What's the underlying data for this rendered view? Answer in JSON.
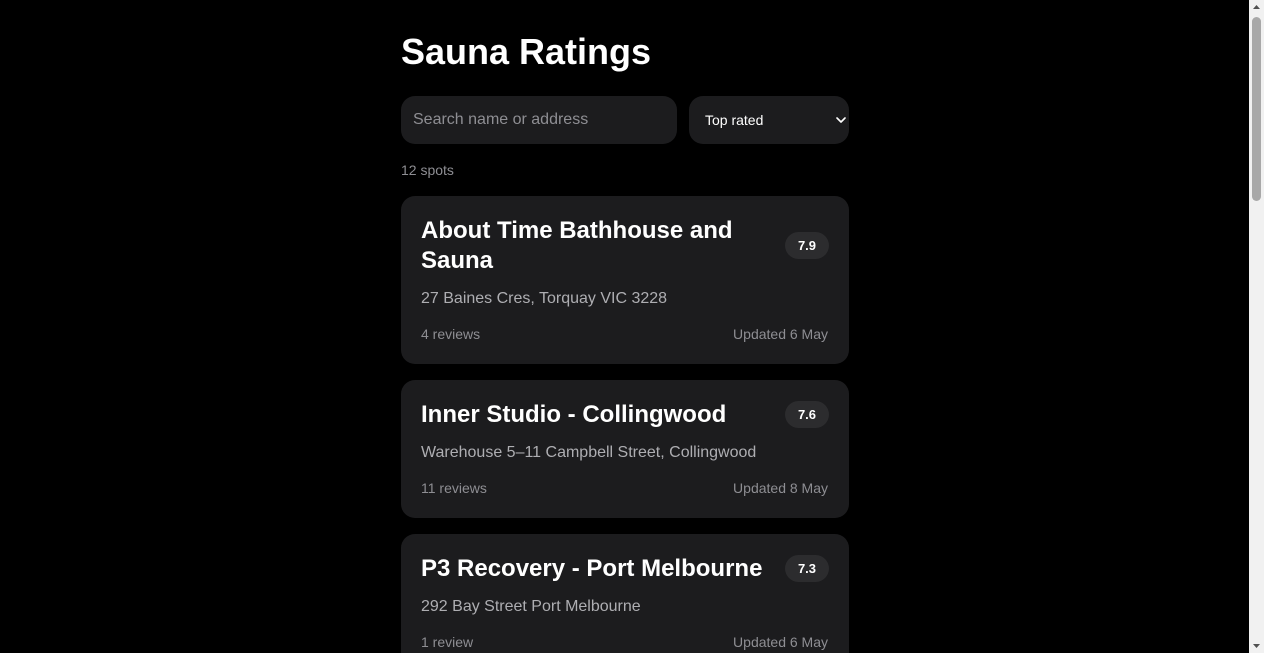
{
  "header": {
    "title": "Sauna Ratings"
  },
  "search": {
    "placeholder": "Search name or address",
    "value": ""
  },
  "sort": {
    "selected": "Top rated"
  },
  "summary": {
    "count_label": "12 spots"
  },
  "spots": [
    {
      "name": "About Time Bathhouse and Sauna",
      "score": "7.9",
      "address": "27 Baines Cres, Torquay VIC 3228",
      "reviews": "4 reviews",
      "updated": "Updated 6 May"
    },
    {
      "name": "Inner Studio - Collingwood",
      "score": "7.6",
      "address": "Warehouse 5–11 Campbell Street, Collingwood",
      "reviews": "11 reviews",
      "updated": "Updated 8 May"
    },
    {
      "name": "P3 Recovery - Port Melbourne",
      "score": "7.3",
      "address": "292 Bay Street Port Melbourne",
      "reviews": "1 review",
      "updated": "Updated 6 May"
    }
  ],
  "colors": {
    "background": "#000000",
    "card": "#1c1c1e",
    "badge": "#2c2c2e",
    "muted_text": "#8e8e93",
    "address_text": "#aeaeb2"
  }
}
